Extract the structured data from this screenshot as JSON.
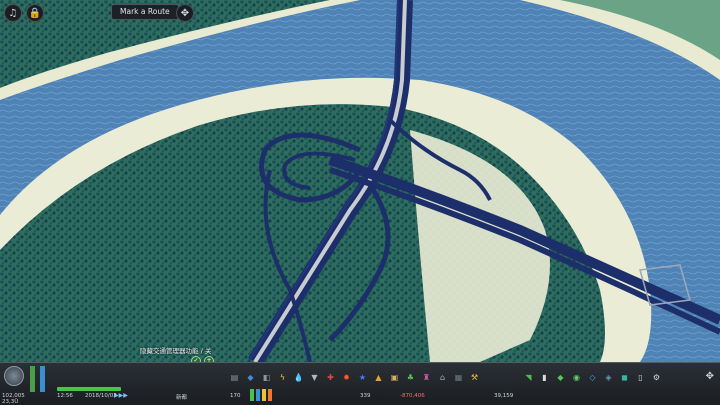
{
  "hud": {
    "mark_route_label": "Mark a Route",
    "hint_text": "隐藏交通管理器功能 / 关",
    "time": "12:56",
    "date": "2018/10/03",
    "speed_indicator": "▶▶▶",
    "money": "39,159",
    "income": "-870,406",
    "population": "339",
    "district_label": "新都",
    "left_stat": "102,005",
    "left_stat2": "23,3Ü",
    "count": "170"
  },
  "icons": [
    "radio-icon",
    "lock-icon",
    "compass-icon"
  ],
  "toolbar": {
    "tools": [
      {
        "name": "road-tool-icon",
        "glyph": "▤",
        "color": "#8d969e"
      },
      {
        "name": "zoning-tool-icon",
        "glyph": "◆",
        "color": "#3f8fd8"
      },
      {
        "name": "district-tool-icon",
        "glyph": "◧",
        "color": "#8d969e"
      },
      {
        "name": "electricity-icon",
        "glyph": "ϟ",
        "color": "#f0c43a"
      },
      {
        "name": "water-icon",
        "glyph": "💧",
        "color": "#3aa0ff"
      },
      {
        "name": "garbage-icon",
        "glyph": "▼",
        "color": "#b0b8c0"
      },
      {
        "name": "health-icon",
        "glyph": "✚",
        "color": "#e04848"
      },
      {
        "name": "fire-icon",
        "glyph": "✹",
        "color": "#ff5a2a"
      },
      {
        "name": "police-icon",
        "glyph": "★",
        "color": "#4a7cff"
      },
      {
        "name": "education-icon",
        "glyph": "▲",
        "color": "#e8a13a"
      },
      {
        "name": "transport-icon",
        "glyph": "▣",
        "color": "#d8b06a"
      },
      {
        "name": "beautification-icon",
        "glyph": "♣",
        "color": "#53c24d"
      },
      {
        "name": "monument-icon",
        "glyph": "♜",
        "color": "#c95aa8"
      },
      {
        "name": "landscaping-icon",
        "glyph": "⌂",
        "color": "#a8b2ba"
      },
      {
        "name": "wonder-icon",
        "glyph": "▦",
        "color": "#6a7a8a"
      },
      {
        "name": "bulldozer-icon",
        "glyph": "⚒",
        "color": "#e8c23a"
      }
    ],
    "right_tools": [
      {
        "name": "economy-icon",
        "glyph": "◥",
        "color": "#4dbb4d"
      },
      {
        "name": "policy-icon",
        "glyph": "▮",
        "color": "#dcdcdc"
      },
      {
        "name": "area-icon",
        "glyph": "◆",
        "color": "#55c955"
      },
      {
        "name": "info-icon",
        "glyph": "◉",
        "color": "#6acb6a"
      },
      {
        "name": "map-icon",
        "glyph": "◇",
        "color": "#4aa3e0"
      },
      {
        "name": "layers-icon",
        "glyph": "◈",
        "color": "#6a9ab5"
      },
      {
        "name": "cube-icon",
        "glyph": "◼",
        "color": "#39b5a0"
      },
      {
        "name": "chart-icon",
        "glyph": "▯",
        "color": "#cfd5da"
      },
      {
        "name": "settings-icon",
        "glyph": "⚙",
        "color": "#cfd5da"
      }
    ]
  }
}
